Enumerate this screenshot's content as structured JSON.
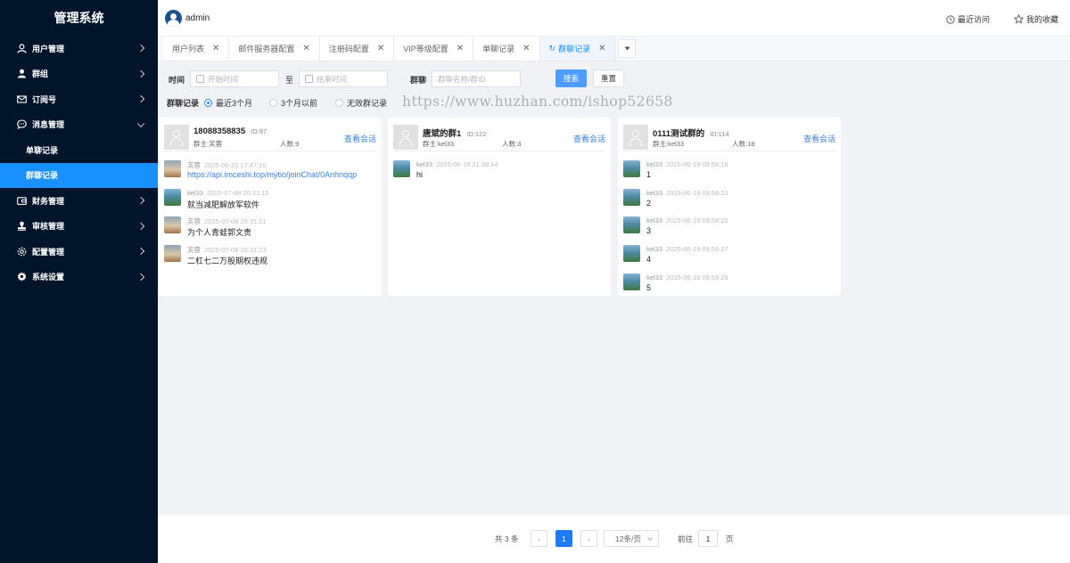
{
  "app_title": "管理系统",
  "sidebar": {
    "items": [
      {
        "label": "用户管理",
        "icon": "user-icon"
      },
      {
        "label": "群组",
        "icon": "user-solid-icon"
      },
      {
        "label": "订阅号",
        "icon": "mail-icon"
      },
      {
        "label": "消息管理",
        "icon": "chat-icon",
        "expanded": true,
        "children": [
          {
            "label": "单聊记录"
          },
          {
            "label": "群聊记录",
            "active": true
          }
        ]
      },
      {
        "label": "财务管理",
        "icon": "wallet-icon"
      },
      {
        "label": "审核管理",
        "icon": "stamp-icon"
      },
      {
        "label": "配置管理",
        "icon": "settings-icon"
      },
      {
        "label": "系统设置",
        "icon": "gear-icon"
      }
    ]
  },
  "header": {
    "username": "admin",
    "recent_label": "最近访问",
    "favorites_label": "我的收藏"
  },
  "tabs": [
    {
      "label": "用户列表"
    },
    {
      "label": "邮件服务器配置"
    },
    {
      "label": "注册码配置"
    },
    {
      "label": "VIP等级配置"
    },
    {
      "label": "单聊记录"
    },
    {
      "label": "群聊记录",
      "active": true
    }
  ],
  "filters": {
    "time_label": "时间",
    "start_placeholder": "开始时间",
    "to_label": "至",
    "end_placeholder": "结束时间",
    "group_label": "群聊",
    "group_placeholder": "群聊名称/群ID",
    "search_label": "搜索",
    "reset_label": "重置",
    "record_label": "群聊记录",
    "radios": [
      {
        "label": "最近3个月",
        "checked": true
      },
      {
        "label": "3个月以前",
        "checked": false
      },
      {
        "label": "无效群记录",
        "checked": false
      }
    ]
  },
  "watermark": "https://www.huzhan.com/ishop52658",
  "groups": [
    {
      "name": "18088358835",
      "id": "ID:97",
      "owner": "群主:芙蓉",
      "members": "人数:9",
      "link": "查看会话",
      "messages": [
        {
          "sender": "芙蓉",
          "time": "2025-06-20 17:47:10",
          "text": "https://api.imceshi.top/mytio/joinChat/0Anhnqqp",
          "avatar": "a",
          "is_link": true
        },
        {
          "sender": "kel33",
          "time": "2025-07-08 20:31:15",
          "text": "就当减肥解放军软件",
          "avatar": "k"
        },
        {
          "sender": "芙蓉",
          "time": "2025-07-08 20:31:21",
          "text": "为个人青蛙郭文贵",
          "avatar": "a"
        },
        {
          "sender": "芙蓉",
          "time": "2025-07-08 20:31:23",
          "text": "二杠七二万股期权违规",
          "avatar": "a"
        }
      ]
    },
    {
      "name": "唐斌的群1",
      "id": "ID:122",
      "owner": "群主:kel33",
      "members": "人数:3",
      "link": "查看会话",
      "messages": [
        {
          "sender": "kel33",
          "time": "2025-06-18 21:38:14",
          "text": "hi",
          "avatar": "k"
        }
      ]
    },
    {
      "name": "0111测试群的",
      "id": "ID:114",
      "owner": "群主:kel33",
      "members": "人数:18",
      "link": "查看会话",
      "messages": [
        {
          "sender": "kel33",
          "time": "2025-06-19 09:58:18",
          "text": "1",
          "avatar": "k"
        },
        {
          "sender": "kel33",
          "time": "2025-06-19 09:58:23",
          "text": "2",
          "avatar": "k"
        },
        {
          "sender": "kel33",
          "time": "2025-06-19 09:58:25",
          "text": "3",
          "avatar": "k"
        },
        {
          "sender": "kel33",
          "time": "2025-06-19 09:58:27",
          "text": "4",
          "avatar": "k"
        },
        {
          "sender": "kel33",
          "time": "2025-06-19 09:58:29",
          "text": "5",
          "avatar": "k"
        }
      ]
    }
  ],
  "pagination": {
    "total": "共 3 条",
    "current": "1",
    "page_size": "12条/页",
    "goto_label": "前往",
    "goto_value": "1",
    "page_suffix": "页"
  },
  "colors": {
    "sidebar_bg": "#001529",
    "accent": "#1890ff",
    "link": "#3b82d9"
  }
}
